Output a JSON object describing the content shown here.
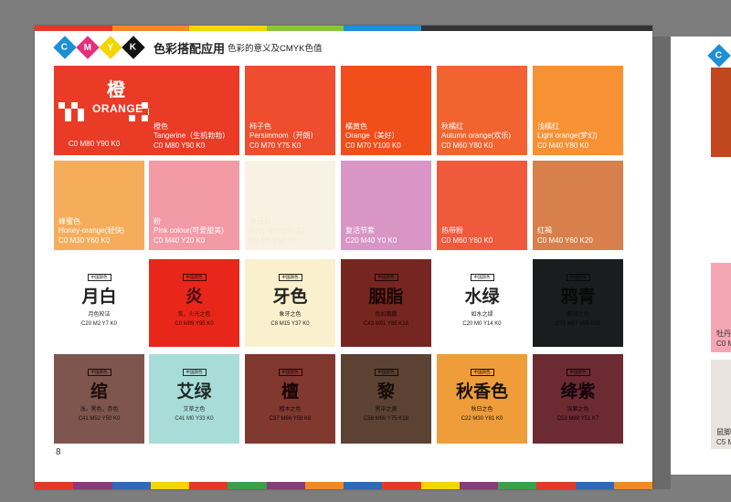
{
  "header": {
    "badges": [
      {
        "letter": "C",
        "color": "#1d8fd6"
      },
      {
        "letter": "M",
        "color": "#e62e7b"
      },
      {
        "letter": "Y",
        "color": "#f5d400"
      },
      {
        "letter": "K",
        "color": "#111111"
      }
    ],
    "title": "色彩搭配应用",
    "subtitle": "色彩的意义及CMYK色值"
  },
  "feature": {
    "char": "橙",
    "word": "ORANGE",
    "cmyk": "C0 M80 Y90 K0",
    "color": "#ea3b26"
  },
  "row1": [
    {
      "lines": [
        "橙色",
        "Tangerine（生机勃勃）",
        "C0 M80 Y90 K0"
      ],
      "color": "#ea3b26"
    },
    {
      "lines": [
        "柿子色",
        "Persimmom（开朗）",
        "C0 M70 Y75 K0"
      ],
      "color": "#ee4d2e"
    },
    {
      "lines": [
        "橘黄色",
        "Orange（美好）",
        "C0 M70 Y100 K0"
      ],
      "color": "#f04e1b"
    },
    {
      "lines": [
        "秋橘红",
        "Autumn orange(欢乐)",
        "C0 M60 Y80 K0"
      ],
      "color": "#f2642f"
    },
    {
      "lines": [
        "浅橘红",
        "Light orange(梦幻)",
        "C0 M40 Y80 K0"
      ],
      "color": "#f69134"
    }
  ],
  "row2": [
    {
      "lines": [
        "蜂蜜色",
        "Honey-orange(轻快)",
        "C0 M30 Y60 K0"
      ],
      "color": "#f5ad5c"
    },
    {
      "lines": [
        "粉",
        "Pink colour(可爱甜美)",
        "C0 M40 Y20 K0"
      ],
      "color": "#f29aa6"
    },
    {
      "lines": [
        "象牙白",
        "Ivory white(纯洁)",
        "C0 M5 Y10 K0"
      ],
      "color": "#f9f2e4"
    },
    {
      "lines": [
        "复活节紫",
        "C20 M40 Y0 K0"
      ],
      "color": "#d995c6"
    },
    {
      "lines": [
        "热带粉",
        "C0 M60 Y60 K0"
      ],
      "color": "#f05a3c"
    },
    {
      "lines": [
        "红褐",
        "C0 M40 Y60 K20"
      ],
      "color": "#d8804c"
    }
  ],
  "row3": [
    {
      "tag": "中国颜色",
      "name": "月白",
      "desc": "月色皎洁",
      "cmyk": "C20 M2 Y7 K0",
      "color": "#ffffff",
      "text": "#222222"
    },
    {
      "tag": "中国颜色",
      "name": "炎",
      "desc": "炭，火光之色",
      "cmyk": "C0 M89 Y95 K0",
      "color": "#e8261a",
      "text": "#3a0d05"
    },
    {
      "tag": "中国颜色",
      "name": "牙色",
      "desc": "象牙之色",
      "cmyk": "C8 M15 Y37 K0",
      "color": "#fbf0cd",
      "text": "#222222"
    },
    {
      "tag": "中国颜色",
      "name": "胭脂",
      "desc": "色如胭脂",
      "cmyk": "C43 M91 Y85 K18",
      "color": "#762621",
      "text": "#1a0504"
    },
    {
      "tag": "中国颜色",
      "name": "水绿",
      "desc": "如水之绿",
      "cmyk": "C20 M0 Y14 K0",
      "color": "#ffffff",
      "text": "#222222"
    },
    {
      "tag": "中国颜色",
      "name": "鸦青",
      "desc": "鸦羽之色",
      "cmyk": "C73 M67 Y56 K35",
      "color": "#1b1c1d",
      "text": "#0a0a0a"
    }
  ],
  "row4": [
    {
      "tag": "中国颜色",
      "name": "绾",
      "desc": "浅，黑色，赤色",
      "cmyk": "C41 M52 Y50 K0",
      "color": "#7e564e",
      "text": "#1d0c08"
    },
    {
      "tag": "中国颜色",
      "name": "艾绿",
      "desc": "艾草之色",
      "cmyk": "C41 M0 Y33 K0",
      "color": "#a8dcd9",
      "text": "#1f2a2a"
    },
    {
      "tag": "中国颜色",
      "name": "檀",
      "desc": "檀木之色",
      "cmyk": "C37 M66 Y59 K8",
      "color": "#80382f",
      "text": "#1a0605"
    },
    {
      "tag": "中国颜色",
      "name": "黎",
      "desc": "黑中之黄",
      "cmyk": "C58 M66 Y75 K18",
      "color": "#5c4233",
      "text": "#140b05"
    },
    {
      "tag": "中国颜色",
      "name": "秋香色",
      "desc": "秋日之色",
      "cmyk": "C22 M30 Y81 K0",
      "color": "#ee9d3a",
      "text": "#1a1206"
    },
    {
      "tag": "中国颜色",
      "name": "绛紫",
      "desc": "深紫之色",
      "cmyk": "C53 M88 Y51 K7",
      "color": "#6c2a32",
      "text": "#12030a"
    }
  ],
  "page_number": "8",
  "right_page": {
    "labels": [
      "牡丹",
      "C0 M",
      "鼠脚",
      "C5 M"
    ]
  }
}
